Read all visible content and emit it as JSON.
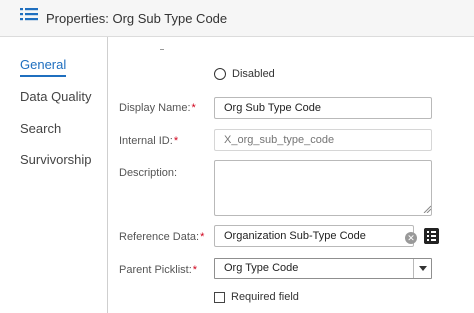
{
  "header": {
    "title": "Properties: Org Sub Type Code",
    "icon": "list-icon",
    "accent": "#1f6fbf"
  },
  "sidebar": {
    "items": [
      {
        "label": "General",
        "active": true
      },
      {
        "label": "Data Quality",
        "active": false
      },
      {
        "label": "Search",
        "active": false
      },
      {
        "label": "Survivorship",
        "active": false
      }
    ]
  },
  "form": {
    "disabled_label": "Disabled",
    "display_name": {
      "label": "Display Name:",
      "required": "*",
      "value": "Org Sub Type Code"
    },
    "internal_id": {
      "label": "Internal ID:",
      "required": "*",
      "value": "X_org_sub_type_code"
    },
    "description": {
      "label": "Description:",
      "value": ""
    },
    "reference_data": {
      "label": "Reference Data:",
      "required": "*",
      "value": "Organization Sub-Type Code",
      "clear_icon": "clear-icon",
      "lookup_icon": "lookup-icon"
    },
    "parent_picklist": {
      "label": "Parent Picklist:",
      "required": "*",
      "selected": "Org Type Code"
    },
    "required_field_label": "Required field",
    "required_color": "#d0021b"
  }
}
